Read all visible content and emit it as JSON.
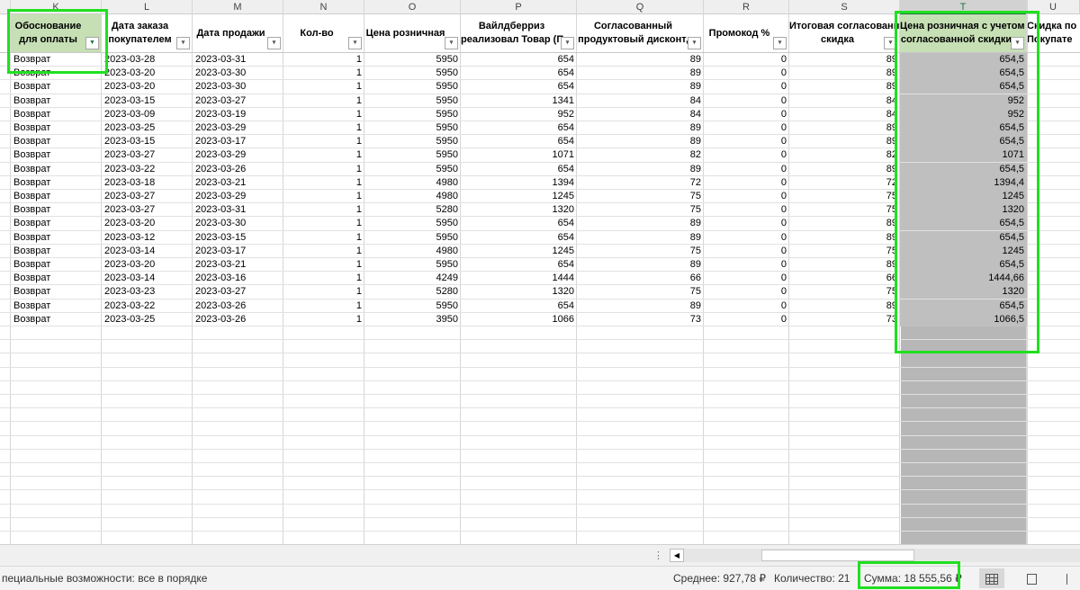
{
  "columns": [
    {
      "letter": "K",
      "header": "Обоснование для оплаты",
      "filter_active": true
    },
    {
      "letter": "L",
      "header_line1": "Дата заказа",
      "header_line2": "покупателем"
    },
    {
      "letter": "M",
      "header": "Дата продажи"
    },
    {
      "letter": "N",
      "header": "Кол-во"
    },
    {
      "letter": "O",
      "header": "Цена розничная"
    },
    {
      "letter": "P",
      "header_line1": "Вайлдберриз",
      "header_line2": "реализовал Товар (П"
    },
    {
      "letter": "Q",
      "header_line1": "Согласованный",
      "header_line2": "продуктовый дисконт,"
    },
    {
      "letter": "R",
      "header": "Промокод %"
    },
    {
      "letter": "S",
      "header_line1": "Итоговая согласованная",
      "header_line2": "скидка"
    },
    {
      "letter": "T",
      "header_line1": "Цена розничная с учетом",
      "header_line2": "согласованной скидки"
    },
    {
      "letter": "U",
      "header_line1": "Скидка по",
      "header_line2": "Покупате"
    }
  ],
  "rows": [
    [
      "Возврат",
      "2023-03-28",
      "2023-03-31",
      "1",
      "5950",
      "654",
      "89",
      "0",
      "89",
      "654,5"
    ],
    [
      "Возврат",
      "2023-03-20",
      "2023-03-30",
      "1",
      "5950",
      "654",
      "89",
      "0",
      "89",
      "654,5"
    ],
    [
      "Возврат",
      "2023-03-20",
      "2023-03-30",
      "1",
      "5950",
      "654",
      "89",
      "0",
      "89",
      "654,5"
    ],
    [
      "Возврат",
      "2023-03-15",
      "2023-03-27",
      "1",
      "5950",
      "1341",
      "84",
      "0",
      "84",
      "952"
    ],
    [
      "Возврат",
      "2023-03-09",
      "2023-03-19",
      "1",
      "5950",
      "952",
      "84",
      "0",
      "84",
      "952"
    ],
    [
      "Возврат",
      "2023-03-25",
      "2023-03-29",
      "1",
      "5950",
      "654",
      "89",
      "0",
      "89",
      "654,5"
    ],
    [
      "Возврат",
      "2023-03-15",
      "2023-03-17",
      "1",
      "5950",
      "654",
      "89",
      "0",
      "89",
      "654,5"
    ],
    [
      "Возврат",
      "2023-03-27",
      "2023-03-29",
      "1",
      "5950",
      "1071",
      "82",
      "0",
      "82",
      "1071"
    ],
    [
      "Возврат",
      "2023-03-22",
      "2023-03-26",
      "1",
      "5950",
      "654",
      "89",
      "0",
      "89",
      "654,5"
    ],
    [
      "Возврат",
      "2023-03-18",
      "2023-03-21",
      "1",
      "4980",
      "1394",
      "72",
      "0",
      "72",
      "1394,4"
    ],
    [
      "Возврат",
      "2023-03-27",
      "2023-03-29",
      "1",
      "4980",
      "1245",
      "75",
      "0",
      "75",
      "1245"
    ],
    [
      "Возврат",
      "2023-03-27",
      "2023-03-31",
      "1",
      "5280",
      "1320",
      "75",
      "0",
      "75",
      "1320"
    ],
    [
      "Возврат",
      "2023-03-20",
      "2023-03-30",
      "1",
      "5950",
      "654",
      "89",
      "0",
      "89",
      "654,5"
    ],
    [
      "Возврат",
      "2023-03-12",
      "2023-03-15",
      "1",
      "5950",
      "654",
      "89",
      "0",
      "89",
      "654,5"
    ],
    [
      "Возврат",
      "2023-03-14",
      "2023-03-17",
      "1",
      "4980",
      "1245",
      "75",
      "0",
      "75",
      "1245"
    ],
    [
      "Возврат",
      "2023-03-20",
      "2023-03-21",
      "1",
      "5950",
      "654",
      "89",
      "0",
      "89",
      "654,5"
    ],
    [
      "Возврат",
      "2023-03-14",
      "2023-03-16",
      "1",
      "4249",
      "1444",
      "66",
      "0",
      "66",
      "1444,66"
    ],
    [
      "Возврат",
      "2023-03-23",
      "2023-03-27",
      "1",
      "5280",
      "1320",
      "75",
      "0",
      "75",
      "1320"
    ],
    [
      "Возврат",
      "2023-03-22",
      "2023-03-26",
      "1",
      "5950",
      "654",
      "89",
      "0",
      "89",
      "654,5"
    ],
    [
      "Возврат",
      "2023-03-25",
      "2023-03-26",
      "1",
      "3950",
      "1066",
      "73",
      "0",
      "73",
      "1066,5"
    ]
  ],
  "status": {
    "accessibility": "пециальные возможности: все в порядке",
    "average": "Среднее: 927,78 ₽",
    "count": "Количество: 21",
    "sum": "Сумма: 18 555,56 ₽"
  },
  "colors": {
    "highlight": "#1fe01f",
    "header_fill": "#c6dfb4",
    "selected_column_fill": "#b7b7b7",
    "excel_green": "#217346"
  }
}
